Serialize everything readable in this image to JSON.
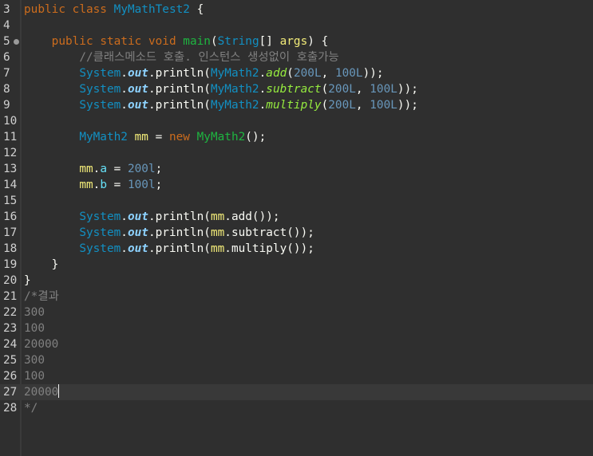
{
  "editor": {
    "language": "java",
    "current_line": 27,
    "colors": {
      "background": "#2f2f2f",
      "current_line": "#393939",
      "keyword": "#cc6c1d",
      "class": "#1290c3",
      "method_declaration": "#1eb540",
      "static_field": "#8dd2ff",
      "static_method": "#96ec3f",
      "number": "#6897bb",
      "comment": "#808080",
      "local_variable": "#f3ec79",
      "field": "#66e1f8"
    },
    "lines": [
      {
        "num": "3",
        "tokens": [
          {
            "t": "public",
            "c": "kw"
          },
          {
            "t": " ",
            "c": "txt"
          },
          {
            "t": "class",
            "c": "kw"
          },
          {
            "t": " ",
            "c": "txt"
          },
          {
            "t": "MyMathTest2",
            "c": "cls"
          },
          {
            "t": " {",
            "c": "txt"
          }
        ]
      },
      {
        "num": "4",
        "tokens": []
      },
      {
        "num": "5",
        "fold": true,
        "tokens": [
          {
            "t": "    ",
            "c": "txt"
          },
          {
            "t": "public",
            "c": "kw"
          },
          {
            "t": " ",
            "c": "txt"
          },
          {
            "t": "static",
            "c": "kw"
          },
          {
            "t": " ",
            "c": "txt"
          },
          {
            "t": "void",
            "c": "kw"
          },
          {
            "t": " ",
            "c": "txt"
          },
          {
            "t": "main",
            "c": "fn"
          },
          {
            "t": "(",
            "c": "txt"
          },
          {
            "t": "String",
            "c": "cls"
          },
          {
            "t": "[] ",
            "c": "txt"
          },
          {
            "t": "args",
            "c": "lvar"
          },
          {
            "t": ") {",
            "c": "txt"
          }
        ]
      },
      {
        "num": "6",
        "tokens": [
          {
            "t": "        ",
            "c": "txt"
          },
          {
            "t": "//클래스메소드 호출. 인스턴스 생성없이 호출가능",
            "c": "cmt"
          }
        ]
      },
      {
        "num": "7",
        "tokens": [
          {
            "t": "        ",
            "c": "txt"
          },
          {
            "t": "System",
            "c": "cls"
          },
          {
            "t": ".",
            "c": "txt"
          },
          {
            "t": "out",
            "c": "sfield"
          },
          {
            "t": ".println(",
            "c": "txt"
          },
          {
            "t": "MyMath2",
            "c": "cls"
          },
          {
            "t": ".",
            "c": "txt"
          },
          {
            "t": "add",
            "c": "sfn"
          },
          {
            "t": "(",
            "c": "txt"
          },
          {
            "t": "200L",
            "c": "num"
          },
          {
            "t": ", ",
            "c": "txt"
          },
          {
            "t": "100L",
            "c": "num"
          },
          {
            "t": "));",
            "c": "txt"
          }
        ]
      },
      {
        "num": "8",
        "tokens": [
          {
            "t": "        ",
            "c": "txt"
          },
          {
            "t": "System",
            "c": "cls"
          },
          {
            "t": ".",
            "c": "txt"
          },
          {
            "t": "out",
            "c": "sfield"
          },
          {
            "t": ".println(",
            "c": "txt"
          },
          {
            "t": "MyMath2",
            "c": "cls"
          },
          {
            "t": ".",
            "c": "txt"
          },
          {
            "t": "subtract",
            "c": "sfn"
          },
          {
            "t": "(",
            "c": "txt"
          },
          {
            "t": "200L",
            "c": "num"
          },
          {
            "t": ", ",
            "c": "txt"
          },
          {
            "t": "100L",
            "c": "num"
          },
          {
            "t": "));",
            "c": "txt"
          }
        ]
      },
      {
        "num": "9",
        "tokens": [
          {
            "t": "        ",
            "c": "txt"
          },
          {
            "t": "System",
            "c": "cls"
          },
          {
            "t": ".",
            "c": "txt"
          },
          {
            "t": "out",
            "c": "sfield"
          },
          {
            "t": ".println(",
            "c": "txt"
          },
          {
            "t": "MyMath2",
            "c": "cls"
          },
          {
            "t": ".",
            "c": "txt"
          },
          {
            "t": "multiply",
            "c": "sfn"
          },
          {
            "t": "(",
            "c": "txt"
          },
          {
            "t": "200L",
            "c": "num"
          },
          {
            "t": ", ",
            "c": "txt"
          },
          {
            "t": "100L",
            "c": "num"
          },
          {
            "t": "));",
            "c": "txt"
          }
        ]
      },
      {
        "num": "10",
        "tokens": []
      },
      {
        "num": "11",
        "tokens": [
          {
            "t": "        ",
            "c": "txt"
          },
          {
            "t": "MyMath2",
            "c": "cls"
          },
          {
            "t": " ",
            "c": "txt"
          },
          {
            "t": "mm",
            "c": "lvar"
          },
          {
            "t": " = ",
            "c": "txt"
          },
          {
            "t": "new",
            "c": "kw"
          },
          {
            "t": " ",
            "c": "txt"
          },
          {
            "t": "MyMath2",
            "c": "fn"
          },
          {
            "t": "();",
            "c": "txt"
          }
        ]
      },
      {
        "num": "12",
        "tokens": []
      },
      {
        "num": "13",
        "tokens": [
          {
            "t": "        ",
            "c": "txt"
          },
          {
            "t": "mm",
            "c": "lvar"
          },
          {
            "t": ".",
            "c": "txt"
          },
          {
            "t": "a",
            "c": "fld"
          },
          {
            "t": " = ",
            "c": "txt"
          },
          {
            "t": "200l",
            "c": "num"
          },
          {
            "t": ";",
            "c": "txt"
          }
        ]
      },
      {
        "num": "14",
        "tokens": [
          {
            "t": "        ",
            "c": "txt"
          },
          {
            "t": "mm",
            "c": "lvar"
          },
          {
            "t": ".",
            "c": "txt"
          },
          {
            "t": "b",
            "c": "fld"
          },
          {
            "t": " = ",
            "c": "txt"
          },
          {
            "t": "100l",
            "c": "num"
          },
          {
            "t": ";",
            "c": "txt"
          }
        ]
      },
      {
        "num": "15",
        "tokens": []
      },
      {
        "num": "16",
        "tokens": [
          {
            "t": "        ",
            "c": "txt"
          },
          {
            "t": "System",
            "c": "cls"
          },
          {
            "t": ".",
            "c": "txt"
          },
          {
            "t": "out",
            "c": "sfield"
          },
          {
            "t": ".println(",
            "c": "txt"
          },
          {
            "t": "mm",
            "c": "lvar"
          },
          {
            "t": ".add());",
            "c": "txt"
          }
        ]
      },
      {
        "num": "17",
        "tokens": [
          {
            "t": "        ",
            "c": "txt"
          },
          {
            "t": "System",
            "c": "cls"
          },
          {
            "t": ".",
            "c": "txt"
          },
          {
            "t": "out",
            "c": "sfield"
          },
          {
            "t": ".println(",
            "c": "txt"
          },
          {
            "t": "mm",
            "c": "lvar"
          },
          {
            "t": ".subtract());",
            "c": "txt"
          }
        ]
      },
      {
        "num": "18",
        "tokens": [
          {
            "t": "        ",
            "c": "txt"
          },
          {
            "t": "System",
            "c": "cls"
          },
          {
            "t": ".",
            "c": "txt"
          },
          {
            "t": "out",
            "c": "sfield"
          },
          {
            "t": ".println(",
            "c": "txt"
          },
          {
            "t": "mm",
            "c": "lvar"
          },
          {
            "t": ".multiply());",
            "c": "txt"
          }
        ]
      },
      {
        "num": "19",
        "tokens": [
          {
            "t": "    }",
            "c": "txt"
          }
        ]
      },
      {
        "num": "20",
        "tokens": [
          {
            "t": "}",
            "c": "txt"
          }
        ]
      },
      {
        "num": "21",
        "tokens": [
          {
            "t": "/*결과",
            "c": "cmt"
          }
        ]
      },
      {
        "num": "22",
        "tokens": [
          {
            "t": "300",
            "c": "cmt"
          }
        ]
      },
      {
        "num": "23",
        "tokens": [
          {
            "t": "100",
            "c": "cmt"
          }
        ]
      },
      {
        "num": "24",
        "tokens": [
          {
            "t": "20000",
            "c": "cmt"
          }
        ]
      },
      {
        "num": "25",
        "tokens": [
          {
            "t": "300",
            "c": "cmt"
          }
        ]
      },
      {
        "num": "26",
        "tokens": [
          {
            "t": "100",
            "c": "cmt"
          }
        ]
      },
      {
        "num": "27",
        "caret": true,
        "tokens": [
          {
            "t": "20000",
            "c": "cmt"
          }
        ]
      },
      {
        "num": "28",
        "tokens": [
          {
            "t": "*/",
            "c": "cmt"
          }
        ]
      }
    ]
  }
}
